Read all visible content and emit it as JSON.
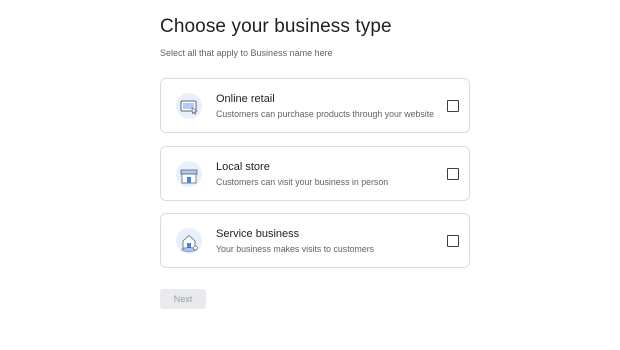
{
  "header": {
    "title": "Choose your business type",
    "subtitle": "Select all that apply to Business name here"
  },
  "options": [
    {
      "title": "Online retail",
      "description": "Customers can purchase products through your website",
      "icon": "online-retail-icon",
      "checked": false
    },
    {
      "title": "Local store",
      "description": "Customers can visit your business in person",
      "icon": "local-store-icon",
      "checked": false
    },
    {
      "title": "Service business",
      "description": "Your business makes visits to customers",
      "icon": "service-business-icon",
      "checked": false
    }
  ],
  "footer": {
    "next_label": "Next"
  },
  "colors": {
    "icon_bg": "#e8f0fe",
    "icon_accent": "#4285f4",
    "border": "#dadce0",
    "disabled_bg": "#e8eaed",
    "disabled_text": "#9aa0a6"
  }
}
